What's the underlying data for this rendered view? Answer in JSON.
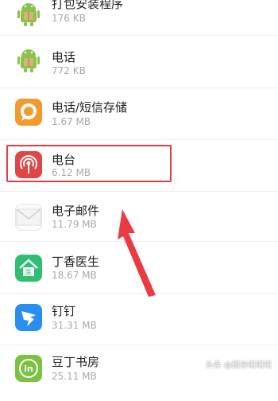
{
  "apps": [
    {
      "name": "打包安装程序",
      "size": "176 KB",
      "icon": "android-icon"
    },
    {
      "name": "电话",
      "size": "772 KB",
      "icon": "android-icon"
    },
    {
      "name": "电话/短信存储",
      "size": "1.67 MB",
      "icon": "chat-bubble-icon"
    },
    {
      "name": "电台",
      "size": "6.12 MB",
      "icon": "radio-broadcast-icon"
    },
    {
      "name": "电子邮件",
      "size": "11.79 MB",
      "icon": "envelope-icon"
    },
    {
      "name": "丁香医生",
      "size": "18.67 MB",
      "icon": "house-doctor-icon"
    },
    {
      "name": "钉钉",
      "size": "31.31 MB",
      "icon": "dingtalk-icon"
    },
    {
      "name": "豆丁书房",
      "size": "25.11 MB",
      "icon": "book-in-icon"
    }
  ],
  "watermark": "头条 @跟亲呢呢呢",
  "colors": {
    "highlight": "#e83a46",
    "android": "#8bc34a",
    "orange": "#f29a2e",
    "radio": "#e04646",
    "dingxiang": "#2ebf72",
    "dingtalk": "#2a8ef0"
  }
}
